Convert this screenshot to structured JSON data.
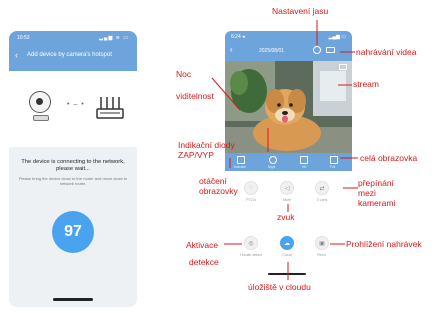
{
  "left_phone": {
    "time": "10:53",
    "signal": "▂▄▆ ≋ ▭",
    "back": "‹",
    "title": "Add device by camera's hotspot",
    "message": "The device is connecting to the network, please wait...",
    "subtext": "Please bring the device close to the router and move close to network router.",
    "progress": "97",
    "progress_value": 97
  },
  "right_phone": {
    "time": "6:24 ◂",
    "status_icons": "▂▄▆ ▭",
    "back": "‹",
    "date": "2025/08/01",
    "bar_labels": [
      "Indicator",
      "Night",
      "HD",
      "Full"
    ]
  },
  "controls": [
    {
      "name": "rotate",
      "label": "PTZ/4",
      "glyph": "◌"
    },
    {
      "name": "sound",
      "label": "Mute",
      "glyph": "◁"
    },
    {
      "name": "switch-cameras",
      "label": "2 Lens",
      "glyph": "⇄"
    },
    {
      "name": "detection",
      "label": "Human detect",
      "glyph": "◎"
    },
    {
      "name": "cloud",
      "label": "Cloud",
      "glyph": "☁"
    },
    {
      "name": "recordings",
      "label": "Recd.",
      "glyph": "▣"
    }
  ],
  "annotations": {
    "nastaveni_jasu": "Nastavení jasu",
    "nahravani_videa": "nahrávání videa",
    "noc": "Noc",
    "viditelnost": "viditelnost",
    "stream": "stream",
    "indikacni_diody": "Indikační diody ZAP/VYP",
    "cela_obrazovka": "celá obrazovka",
    "otaceni_obrazovky": "otáčení obrazovky",
    "prepinani_mezi_kamerami": "přepínání mezi kamerami",
    "zvuk": "zvuk",
    "aktivace": "Aktivace",
    "detekce": "detekce",
    "prohlizeni_nahravek": "Prohlížení nahrávek",
    "uloziste_v_cloudu": "úložiště v cloudu"
  },
  "colors": {
    "brand_blue": "#6ea4dc",
    "accent_blue": "#4aa3ee",
    "annotation_red": "#d61a1a"
  }
}
